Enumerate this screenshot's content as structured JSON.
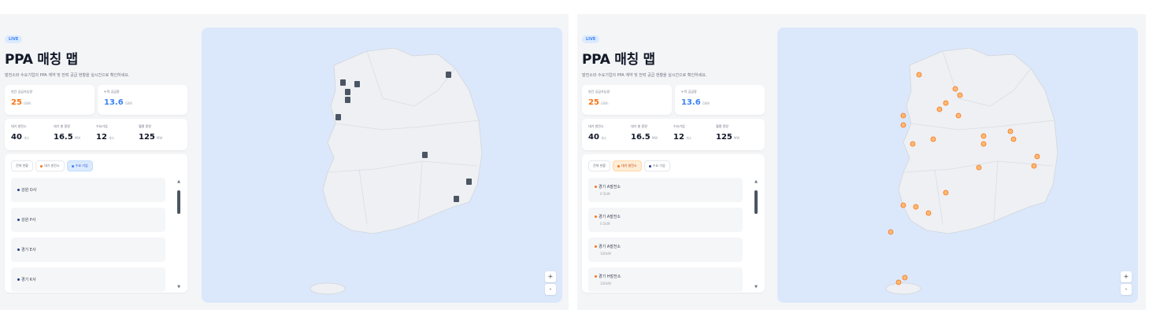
{
  "left": {
    "badge": "LIVE",
    "title": "PPA 매칭 맵",
    "subtitle": "발전소와 수요기업의 PPA 계약 및 전력 공급 현황을 실시간으로 확인하세요.",
    "kpi_supply": {
      "label": "연간 공급가능량",
      "value": "25",
      "unit": "GWh"
    },
    "kpi_total": {
      "label": "누적 공급량",
      "value": "13.6",
      "unit": "GWh"
    },
    "stats": [
      {
        "label": "대기 발전소",
        "value": "40",
        "unit": "개소"
      },
      {
        "label": "대기 총 용량",
        "value": "16.5",
        "unit": "MW"
      },
      {
        "label": "수요기업",
        "value": "12",
        "unit": "개소"
      },
      {
        "label": "월평 용량",
        "value": "125",
        "unit": "MW"
      }
    ],
    "filters": {
      "all": "전체 현황",
      "plants": "대기 발전소",
      "buyers": "수요 기업"
    },
    "items": [
      {
        "name": "강원 O사"
      },
      {
        "name": "강원 P사"
      },
      {
        "name": "경기 E사"
      },
      {
        "name": "경기 K사"
      }
    ],
    "zoom_in": "+",
    "zoom_out": "-"
  },
  "right": {
    "badge": "LIVE",
    "title": "PPA 매칭 맵",
    "subtitle": "발전소와 수요기업의 PPA 계약 및 전력 공급 현황을 실시간으로 확인하세요.",
    "kpi_supply": {
      "label": "연간 공급가능량",
      "value": "25",
      "unit": "GWh"
    },
    "kpi_total": {
      "label": "누적 공급량",
      "value": "13.6",
      "unit": "GWh"
    },
    "stats": [
      {
        "label": "대기 발전소",
        "value": "40",
        "unit": "개소"
      },
      {
        "label": "대기 총 용량",
        "value": "16.5",
        "unit": "MW"
      },
      {
        "label": "수요기업",
        "value": "12",
        "unit": "개소"
      },
      {
        "label": "월평 용량",
        "value": "125",
        "unit": "MW"
      }
    ],
    "filters": {
      "all": "전체 현황",
      "plants": "대기 발전소",
      "buyers": "수요 기업"
    },
    "items": [
      {
        "name": "경기 A발전소",
        "sub": "0.5kW"
      },
      {
        "name": "경기 A발전소",
        "sub": "0.5kW"
      },
      {
        "name": "경기 A발전소",
        "sub": "100kW"
      },
      {
        "name": "경기 H발전소",
        "sub": "100kW"
      }
    ],
    "zoom_in": "+",
    "zoom_out": "-"
  },
  "colors": {
    "plant": "#f97316",
    "buyer": "#3b82f6",
    "map_bg": "#dbe8fb",
    "land": "#eef0f3"
  },
  "icons": {
    "buyer_marker": "building-icon",
    "plant_marker": "solar-plant-icon"
  }
}
